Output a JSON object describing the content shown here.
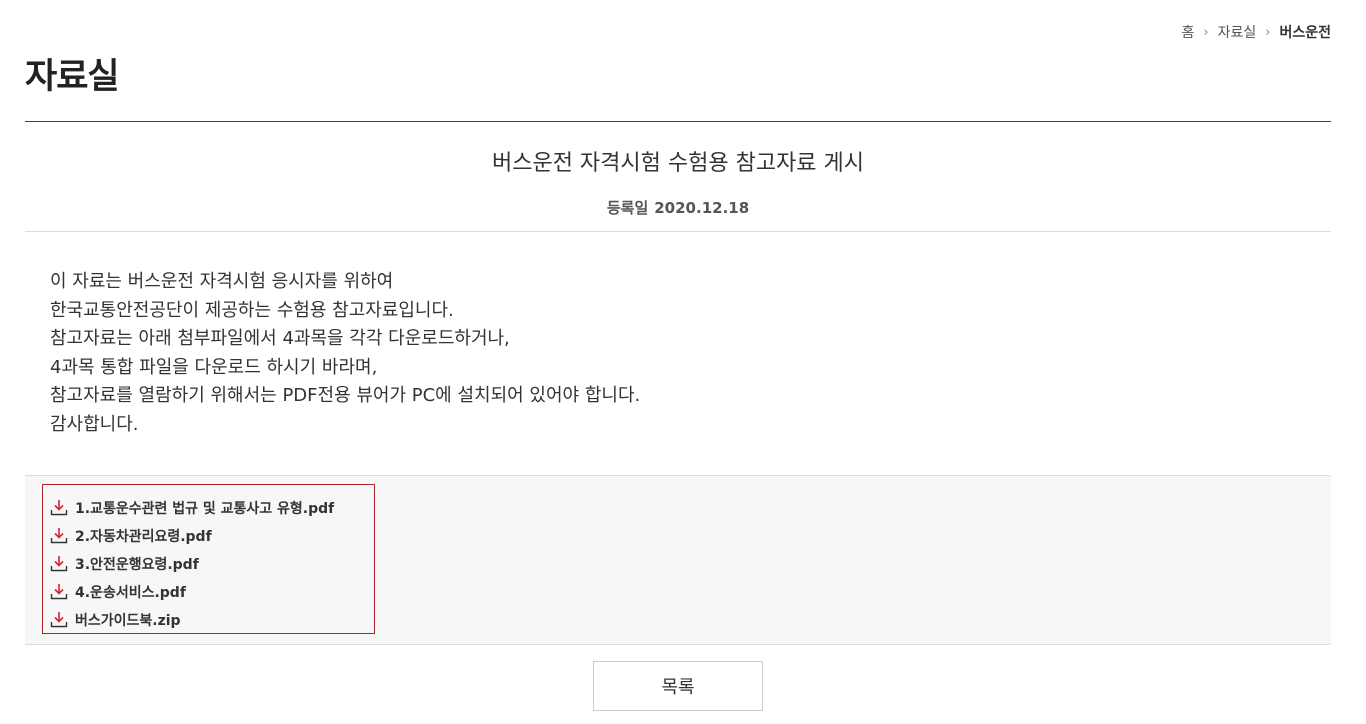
{
  "breadcrumb": {
    "home": "홈",
    "section": "자료실",
    "current": "버스운전"
  },
  "page": {
    "title": "자료실"
  },
  "post": {
    "title": "버스운전 자격시험 수험용 참고자료 게시",
    "date_label": "등록일",
    "date": "2020.12.18",
    "body_lines": [
      "이 자료는 버스운전 자격시험 응시자를 위하여",
      "한국교통안전공단이 제공하는 수험용 참고자료입니다.",
      "참고자료는 아래 첨부파일에서 4과목을 각각 다운로드하거나,",
      "4과목 통합 파일을 다운로드 하시기 바라며,",
      "참고자료를 열람하기 위해서는 PDF전용 뷰어가 PC에 설치되어 있어야 합니다.",
      "감사합니다."
    ]
  },
  "attachments": [
    {
      "name": "1.교통운수관련 법규 및 교통사고 유형.pdf",
      "icon": "download-icon"
    },
    {
      "name": "2.자동차관리요령.pdf",
      "icon": "download-icon"
    },
    {
      "name": "3.안전운행요령.pdf",
      "icon": "download-icon"
    },
    {
      "name": "4.운송서비스.pdf",
      "icon": "download-icon"
    },
    {
      "name": "버스가이드북.zip",
      "icon": "download-icon"
    }
  ],
  "buttons": {
    "list_label": "목록"
  },
  "colors": {
    "download_icon_arrow": "#d9232d",
    "attachment_border": "#b2222b",
    "attachment_bg": "#f7f7f7",
    "title_rule": "#444444"
  }
}
